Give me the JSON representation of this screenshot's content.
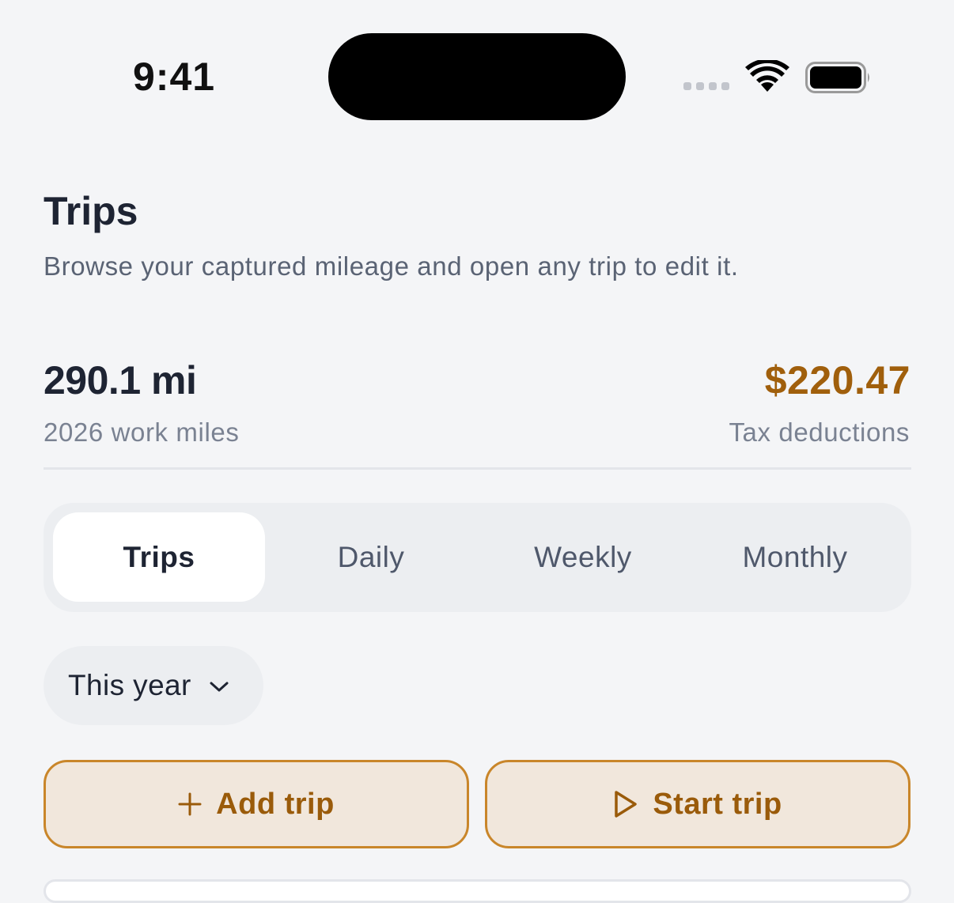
{
  "status_bar": {
    "time": "9:41",
    "icons": [
      "cellular-signal-icon",
      "wifi-icon",
      "battery-icon"
    ]
  },
  "header": {
    "title": "Trips",
    "subtitle": "Browse your captured mileage and open any trip to edit it."
  },
  "stats": {
    "miles_value": "290.1 mi",
    "miles_label": "2026 work miles",
    "deduction_value": "$220.47",
    "deduction_label": "Tax deductions"
  },
  "tabs": [
    {
      "label": "Trips",
      "active": true
    },
    {
      "label": "Daily",
      "active": false
    },
    {
      "label": "Weekly",
      "active": false
    },
    {
      "label": "Monthly",
      "active": false
    }
  ],
  "filter": {
    "label": "This year",
    "icon": "chevron-down-icon"
  },
  "actions": {
    "add_label": "Add trip",
    "add_icon": "plus-icon",
    "start_label": "Start trip",
    "start_icon": "play-icon"
  },
  "colors": {
    "accent": "#a05f0c",
    "button_fill": "#f1e7dc",
    "button_border": "#c9862a",
    "background": "#f4f5f7"
  }
}
